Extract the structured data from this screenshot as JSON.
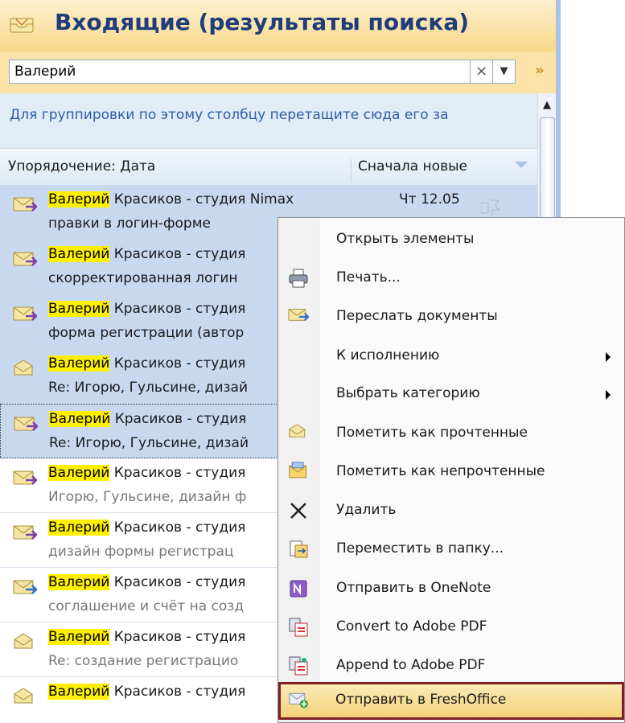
{
  "pane": {
    "title": "Входящие (результаты поиска)",
    "search_value": "Валерий",
    "clear_glyph": "×",
    "dropdown_glyph": "▼",
    "expand_glyph": "»",
    "group_hint": "Для группировки по этому столбцу перетащите сюда его за",
    "sort_label": "Упорядочение: Дата",
    "order_label": "Сначала новые"
  },
  "rows": [
    {
      "hl": "Валерий",
      "rest": " Красиков - студия Nimax",
      "subject": "правки в логин-форме",
      "date": "Чт 12.05",
      "state": "selected",
      "icon": "reply-envelope-icon"
    },
    {
      "hl": "Валерий",
      "rest": " Красиков - студия",
      "subject": "скорректированная логин",
      "date": "",
      "state": "selected",
      "icon": "reply-envelope-icon"
    },
    {
      "hl": "Валерий",
      "rest": " Красиков - студия",
      "subject": "форма регистрации (автор",
      "date": "",
      "state": "selected",
      "icon": "reply-envelope-icon"
    },
    {
      "hl": "Валерий",
      "rest": " Красиков - студия",
      "subject": "Re: Игорю, Гульсине, дизай",
      "date": "",
      "state": "selected",
      "icon": "envelope-open-icon"
    },
    {
      "hl": "Валерий",
      "rest": " Красиков - студия",
      "subject": "Re: Игорю, Гульсине, дизай",
      "date": "",
      "state": "selected-focus",
      "icon": "reply-envelope-icon"
    },
    {
      "hl": "Валерий",
      "rest": " Красиков - студия",
      "subject": "Игорю, Гульсине, дизайн ф",
      "date": "",
      "state": "read",
      "icon": "reply-envelope-icon"
    },
    {
      "hl": "Валерий",
      "rest": " Красиков - студия",
      "subject": "дизайн формы регистрац",
      "date": "",
      "state": "read",
      "icon": "reply-envelope-icon"
    },
    {
      "hl": "Валерий",
      "rest": " Красиков - студия",
      "subject": "соглашение и счёт на созд",
      "date": "",
      "state": "read",
      "icon": "forward-envelope-icon"
    },
    {
      "hl": "Валерий",
      "rest": " Красиков - студия",
      "subject": "Re: создание регистрацио",
      "date": "",
      "state": "read",
      "icon": "envelope-open-icon"
    },
    {
      "hl": "Валерий",
      "rest": " Красиков - студия",
      "subject": "",
      "date": "",
      "state": "read",
      "icon": "envelope-open-icon"
    }
  ],
  "menu": {
    "items": [
      {
        "name": "open-items",
        "label": "Открыть элементы",
        "icon": "",
        "submenu": false
      },
      {
        "name": "print",
        "label": "Печать...",
        "icon": "printer-icon",
        "submenu": false
      },
      {
        "name": "forward-documents",
        "label": "Переслать документы",
        "icon": "forward-envelope-icon",
        "submenu": false
      },
      {
        "name": "follow-up",
        "label": "К исполнению",
        "icon": "",
        "submenu": true
      },
      {
        "name": "categorize",
        "label": "Выбрать категорию",
        "icon": "",
        "submenu": true
      },
      {
        "name": "mark-read",
        "label": "Пометить как прочтенные",
        "icon": "envelope-open-icon",
        "submenu": false
      },
      {
        "name": "mark-unread",
        "label": "Пометить как непрочтенные",
        "icon": "envelope-closed-icon",
        "submenu": false
      },
      {
        "name": "delete",
        "label": "Удалить",
        "icon": "delete-x-icon",
        "submenu": false
      },
      {
        "name": "move-to-folder",
        "label": "Переместить в папку...",
        "icon": "move-folder-icon",
        "submenu": false
      },
      {
        "name": "send-to-onenote",
        "label": "Отправить в OneNote",
        "icon": "onenote-icon",
        "submenu": false
      },
      {
        "name": "convert-to-pdf",
        "label": "Convert to Adobe PDF",
        "icon": "pdf-convert-icon",
        "submenu": false
      },
      {
        "name": "append-to-pdf",
        "label": "Append to Adobe PDF",
        "icon": "pdf-append-icon",
        "submenu": false
      },
      {
        "name": "send-to-freshoffice",
        "label": "Отправить в FreshOffice",
        "icon": "freshoffice-icon",
        "submenu": false,
        "highlighted": true
      }
    ]
  },
  "colors": {
    "highlight": "#fff000",
    "selection": "#c8d9ef",
    "menu_hot_border": "#7d1f24",
    "title_text": "#1f3d7a"
  }
}
